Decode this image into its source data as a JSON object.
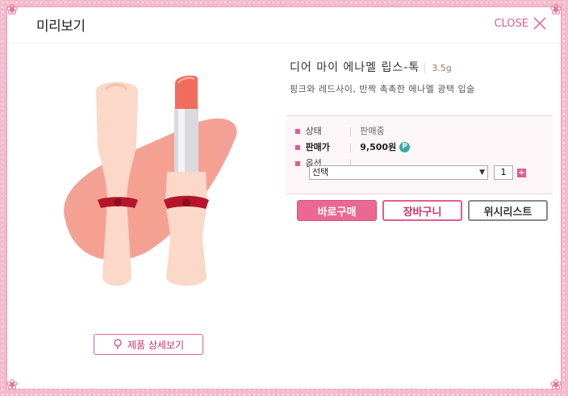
{
  "popup": {
    "title": "미리보기",
    "close_label": "CLOSE"
  },
  "product": {
    "name": "디어 마이 에나멜 립스-톡",
    "volume": "3.5g",
    "description": "핑크와 레드사이, 반짝 촉촉한 에나멜 광택 입술",
    "image_alt": "lipstick-product-image"
  },
  "info": {
    "status_label": "상태",
    "status_value": "판매중",
    "price_label": "판매가",
    "price_value": "9,500원",
    "point_badge": "P",
    "option_label": "옵션"
  },
  "option_select": {
    "selected": "선택"
  },
  "quantity": {
    "value": "1"
  },
  "actions": {
    "buy_now": "바로구매",
    "cart": "장바구니",
    "wishlist": "위시리스트",
    "detail_view": "제품 상세보기"
  },
  "colors": {
    "accent_pink": "#e05d8c",
    "buy_button": "#ea6892",
    "frame": "#f5b8cc",
    "point_badge": "#39a9a8"
  }
}
